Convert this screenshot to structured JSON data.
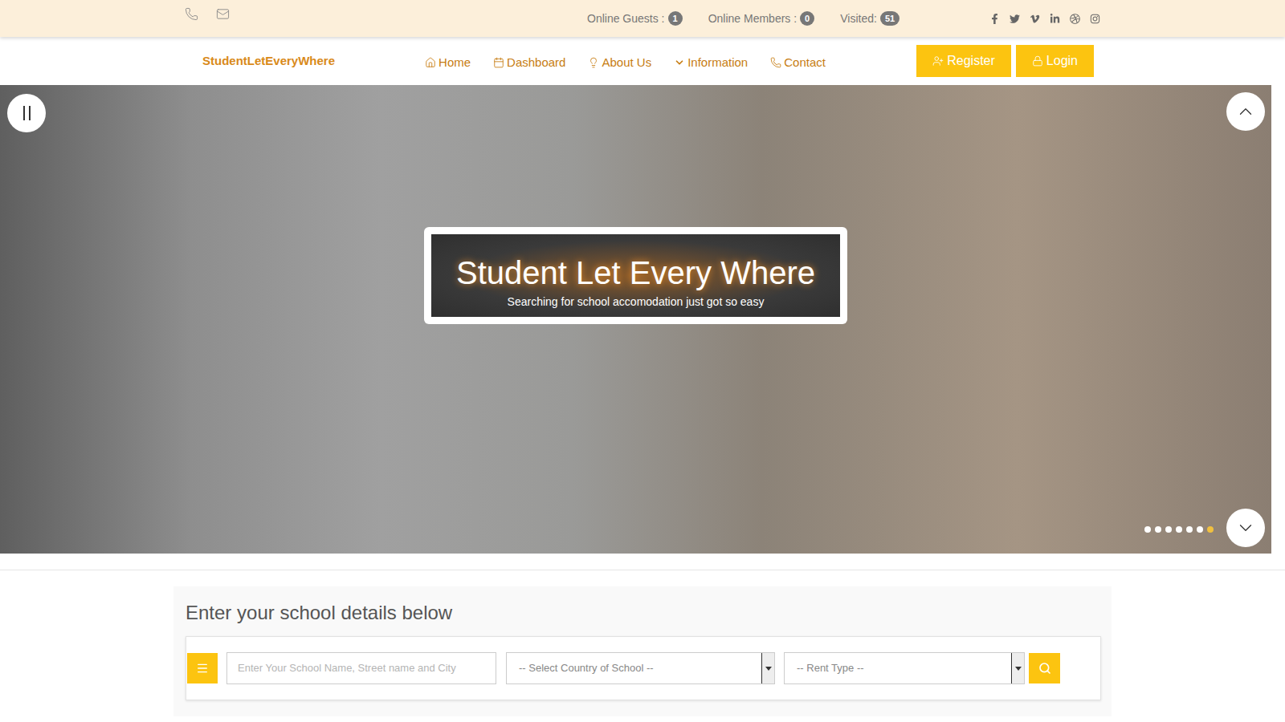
{
  "topbar": {
    "stats": [
      {
        "label": "Online Guests :",
        "count": "1"
      },
      {
        "label": "Online Members :",
        "count": "0"
      },
      {
        "label": "Visited:",
        "count": "51"
      }
    ]
  },
  "nav": {
    "brand": "StudentLetEveryWhere",
    "items": [
      {
        "label": "Home",
        "icon": "home"
      },
      {
        "label": "Dashboard",
        "icon": "dashboard"
      },
      {
        "label": "About Us",
        "icon": "about"
      },
      {
        "label": "Information",
        "icon": "caret"
      },
      {
        "label": "Contact",
        "icon": "phone"
      }
    ],
    "buttons": [
      {
        "label": "Register",
        "icon": "register"
      },
      {
        "label": "Login",
        "icon": "login"
      }
    ]
  },
  "hero": {
    "title": "Student Let Every Where",
    "subtitle": "Searching for school accomodation just got so easy",
    "slides": [
      {
        "selected": false
      },
      {
        "selected": false
      },
      {
        "selected": false
      },
      {
        "selected": false
      },
      {
        "selected": false
      },
      {
        "selected": false
      },
      {
        "selected": true
      }
    ]
  },
  "search": {
    "heading": "Enter your school details below",
    "placeholder": "Enter Your School Name, Street name and City",
    "country": "-- Select Country of School --",
    "rent": "-- Rent Type --"
  }
}
